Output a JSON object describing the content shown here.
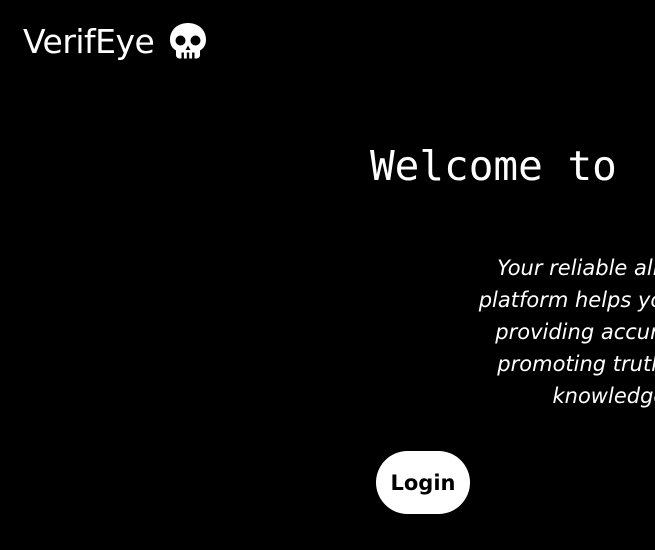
{
  "header": {
    "brand_name": "VerifEye",
    "brand_icon": "skull-icon"
  },
  "hero": {
    "title": "Welcome to",
    "description": "Your reliable ally in the figh platform helps you navigate th providing accurate and trus promoting truth and transp knowledgeable c",
    "description_lines": [
      "Your reliable ally in the figh",
      "platform helps you navigate th",
      "providing accurate and trus",
      "promoting truth and transp",
      "knowledgeable c"
    ]
  },
  "actions": {
    "login_label": "Login"
  },
  "colors": {
    "background": "#000000",
    "text": "#ffffff",
    "button_bg": "#ffffff",
    "button_text": "#000000"
  }
}
